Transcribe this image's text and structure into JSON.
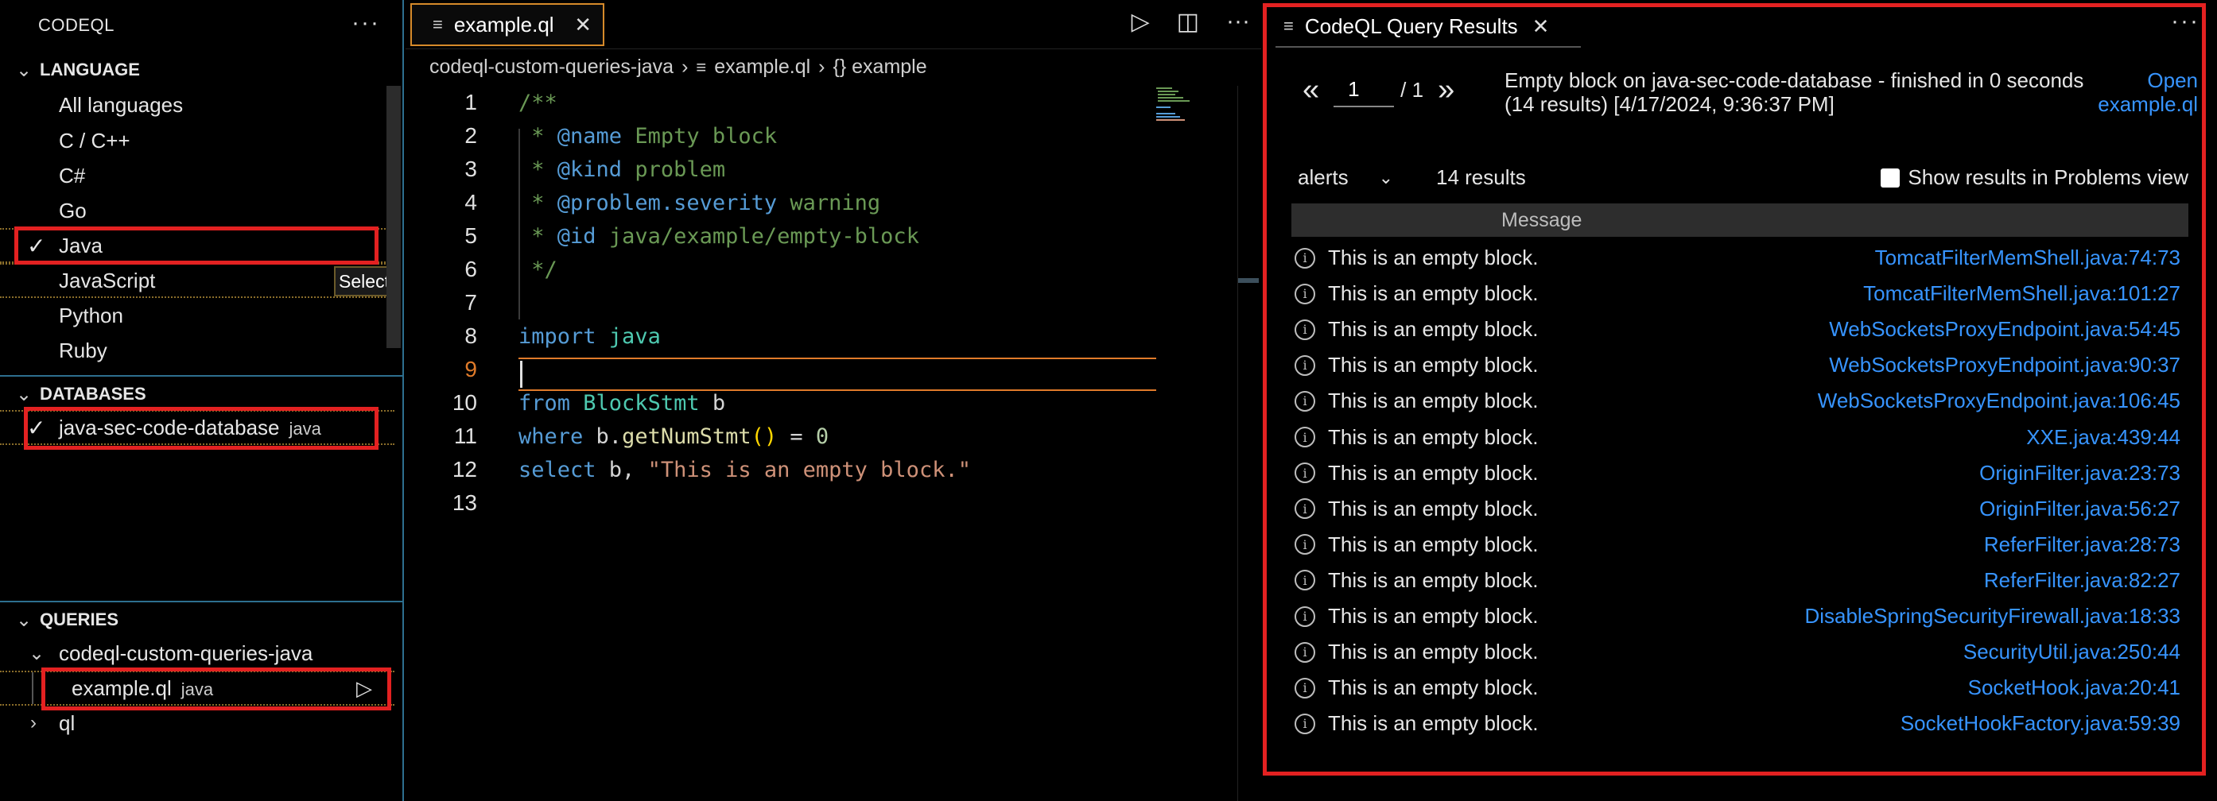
{
  "sidebar": {
    "title": "CODEQL",
    "more": "···",
    "language": {
      "title": "LANGUAGE",
      "items": [
        "All languages",
        "C / C++",
        "C#",
        "Go",
        "Java",
        "JavaScript",
        "Python",
        "Ruby"
      ],
      "selected": "Java",
      "hover_item": "JavaScript",
      "select_label": "Select"
    },
    "databases": {
      "title": "DATABASES",
      "items": [
        {
          "name": "java-sec-code-database",
          "lang": "java"
        }
      ]
    },
    "queries": {
      "title": "QUERIES",
      "folder": "codeql-custom-queries-java",
      "file": {
        "name": "example.ql",
        "lang": "java"
      },
      "other": "ql"
    }
  },
  "editor": {
    "tab": {
      "label": "example.ql"
    },
    "breadcrumb": [
      "codeql-custom-queries-java",
      "example.ql",
      "{} example"
    ],
    "active_line": 9,
    "lines": [
      {
        "n": "1"
      },
      {
        "n": "2"
      },
      {
        "n": "3"
      },
      {
        "n": "4"
      },
      {
        "n": "5"
      },
      {
        "n": "6"
      },
      {
        "n": "7"
      },
      {
        "n": "8"
      },
      {
        "n": "9"
      },
      {
        "n": "10"
      },
      {
        "n": "11"
      },
      {
        "n": "12"
      },
      {
        "n": "13"
      }
    ],
    "code": {
      "l1": "/**",
      "l2a": " * ",
      "l2b": "@name",
      "l2c": " Empty block",
      "l3a": " * ",
      "l3b": "@kind",
      "l3c": " problem",
      "l4a": " * ",
      "l4b": "@problem.severity",
      "l4c": " warning",
      "l5a": " * ",
      "l5b": "@id",
      "l5c": " java/example/empty-block",
      "l6": " */",
      "l8a": "import",
      "l8b": " java",
      "l10a": "from",
      "l10b": " BlockStmt",
      "l10c": " b",
      "l11a": "where",
      "l11b": " b.",
      "l11c": "getNumStmt",
      "l11d": "()",
      "l11e": " = ",
      "l11f": "0",
      "l12a": "select",
      "l12b": " b, ",
      "l12c": "\"This is an empty block.\""
    }
  },
  "results": {
    "tab_label": "CodeQL Query Results",
    "more": "···",
    "page": "1",
    "page_total": "/ 1",
    "info": "Empty block on java-sec-code-database - finished in 0 seconds (14 results) [4/17/2024, 9:36:37 PM]",
    "open_link": "Open example.ql",
    "result_set": "alerts",
    "count": "14 results",
    "show_in_problems": "Show results in Problems view",
    "column_header": "Message",
    "rows": [
      {
        "msg": "This is an empty block.",
        "loc": "TomcatFilterMemShell.java:74:73"
      },
      {
        "msg": "This is an empty block.",
        "loc": "TomcatFilterMemShell.java:101:27"
      },
      {
        "msg": "This is an empty block.",
        "loc": "WebSocketsProxyEndpoint.java:54:45"
      },
      {
        "msg": "This is an empty block.",
        "loc": "WebSocketsProxyEndpoint.java:90:37"
      },
      {
        "msg": "This is an empty block.",
        "loc": "WebSocketsProxyEndpoint.java:106:45"
      },
      {
        "msg": "This is an empty block.",
        "loc": "XXE.java:439:44"
      },
      {
        "msg": "This is an empty block.",
        "loc": "OriginFilter.java:23:73"
      },
      {
        "msg": "This is an empty block.",
        "loc": "OriginFilter.java:56:27"
      },
      {
        "msg": "This is an empty block.",
        "loc": "ReferFilter.java:28:73"
      },
      {
        "msg": "This is an empty block.",
        "loc": "ReferFilter.java:82:27"
      },
      {
        "msg": "This is an empty block.",
        "loc": "DisableSpringSecurityFirewall.java:18:33"
      },
      {
        "msg": "This is an empty block.",
        "loc": "SecurityUtil.java:250:44"
      },
      {
        "msg": "This is an empty block.",
        "loc": "SocketHook.java:20:41"
      },
      {
        "msg": "This is an empty block.",
        "loc": "SocketHookFactory.java:59:39"
      }
    ]
  },
  "colors": {
    "highlight_box": "#e32121",
    "link": "#3794ff",
    "tab_border": "#d68a2a"
  }
}
